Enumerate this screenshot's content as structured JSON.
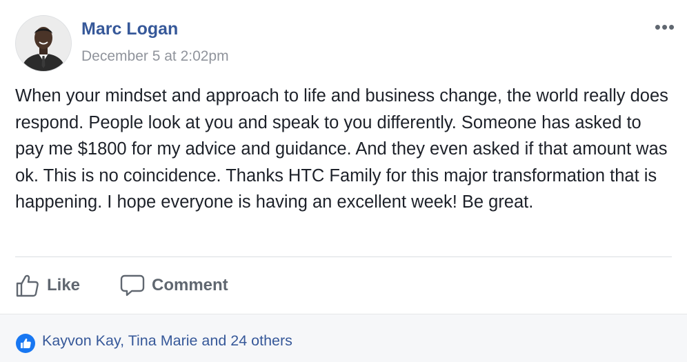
{
  "post": {
    "author": "Marc Logan",
    "timestamp": "December 5 at 2:02pm",
    "more_label": "•••",
    "body": "When your mindset and approach to life and business change, the world really does respond. People look at you and speak to you differently. Someone has asked to pay me $1800 for my advice and guidance. And they even asked if that amount was ok. This is no coincidence. Thanks HTC Family for this major transformation that is happening. I hope everyone is having an excellent week! Be great."
  },
  "actions": {
    "like_label": "Like",
    "comment_label": "Comment"
  },
  "reactions": {
    "summary": "Kayvon Kay, Tina Marie and 24 others",
    "icon": "like-icon"
  },
  "colors": {
    "author_link": "#365899",
    "timestamp": "#90949c",
    "action_text": "#606770",
    "reaction_blue": "#1877f2",
    "footer_bg": "#f6f7f9"
  }
}
